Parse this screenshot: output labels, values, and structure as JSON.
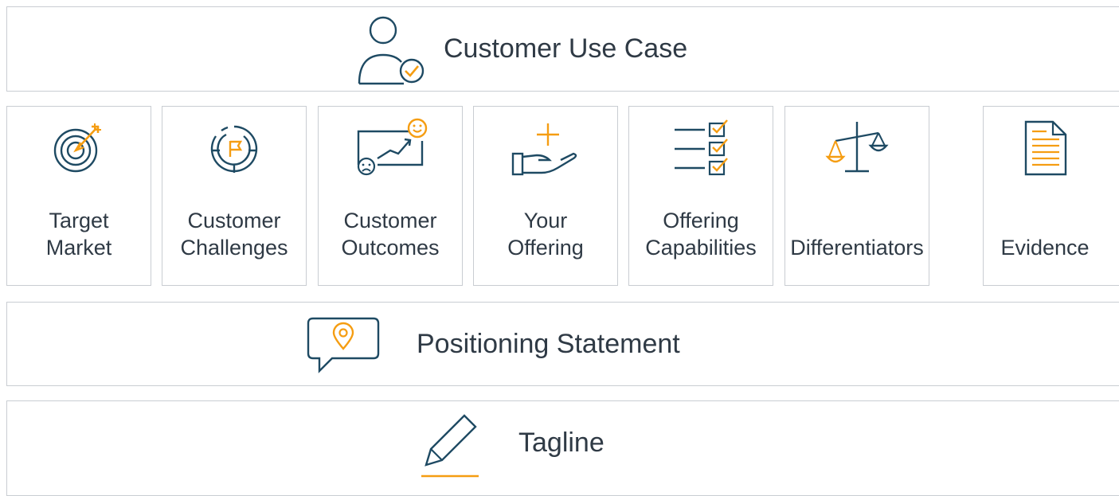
{
  "header": {
    "title": "Customer Use Case",
    "icon": "user-check-icon"
  },
  "cards": [
    {
      "id": "target-market",
      "lines": [
        "Target",
        "Market"
      ],
      "icon": "target-arrow-icon"
    },
    {
      "id": "customer-challenges",
      "lines": [
        "Customer",
        "Challenges"
      ],
      "icon": "maze-flag-icon"
    },
    {
      "id": "customer-outcomes",
      "lines": [
        "Customer",
        "Outcomes"
      ],
      "icon": "sad-to-happy-chart-icon"
    },
    {
      "id": "your-offering",
      "lines": [
        "Your",
        "Offering"
      ],
      "icon": "hand-offering-plus-icon"
    },
    {
      "id": "offering-capabilities",
      "lines": [
        "Offering",
        "Capabilities"
      ],
      "icon": "checklist-icon"
    },
    {
      "id": "differentiators",
      "lines": [
        "Differentiators"
      ],
      "icon": "balance-scale-icon"
    },
    {
      "id": "evidence",
      "lines": [
        "Evidence"
      ],
      "icon": "document-icon"
    }
  ],
  "positioning": {
    "title": "Positioning Statement",
    "icon": "speech-bubble-pin-icon"
  },
  "tagline": {
    "title": "Tagline",
    "icon": "pencil-icon"
  },
  "colors": {
    "outline": "#1e4a63",
    "accent": "#f59d12",
    "border": "#c9cdd2",
    "text": "#2f3a45"
  }
}
